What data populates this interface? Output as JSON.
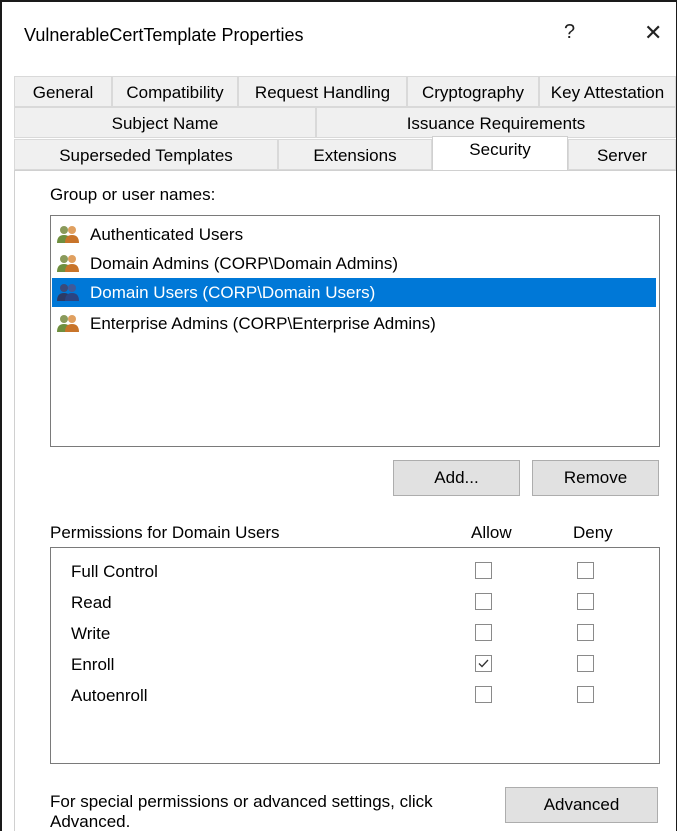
{
  "window": {
    "title": "VulnerableCertTemplate Properties",
    "help_glyph": "?",
    "close_glyph": "✕"
  },
  "tabs": {
    "row1": [
      "General",
      "Compatibility",
      "Request Handling",
      "Cryptography",
      "Key Attestation"
    ],
    "row2": [
      "Subject Name",
      "Issuance Requirements"
    ],
    "row3": [
      "Superseded Templates",
      "Extensions",
      "Security",
      "Server"
    ],
    "active": "Security"
  },
  "security": {
    "group_label": "Group or user names:",
    "users": [
      {
        "name": "Authenticated Users",
        "selected": false,
        "icon": "users-icon"
      },
      {
        "name": "Domain Admins (CORP\\Domain Admins)",
        "selected": false,
        "icon": "users-icon"
      },
      {
        "name": "Domain Users (CORP\\Domain Users)",
        "selected": true,
        "icon": "users-icon"
      },
      {
        "name": "Enterprise Admins (CORP\\Enterprise Admins)",
        "selected": false,
        "icon": "users-icon"
      }
    ],
    "add_label": "Add...",
    "remove_label": "Remove",
    "permissions_label": "Permissions for Domain Users",
    "allow_header": "Allow",
    "deny_header": "Deny",
    "permissions": [
      {
        "name": "Full Control",
        "allow": false,
        "deny": false
      },
      {
        "name": "Read",
        "allow": false,
        "deny": false
      },
      {
        "name": "Write",
        "allow": false,
        "deny": false
      },
      {
        "name": "Enroll",
        "allow": true,
        "deny": false
      },
      {
        "name": "Autoenroll",
        "allow": false,
        "deny": false
      }
    ],
    "footer_text_line1": "For special permissions or advanced settings, click",
    "footer_text_line2": "Advanced.",
    "advanced_label": "Advanced"
  },
  "colors": {
    "selection": "#0078d7",
    "button_face": "#e1e1e1"
  }
}
